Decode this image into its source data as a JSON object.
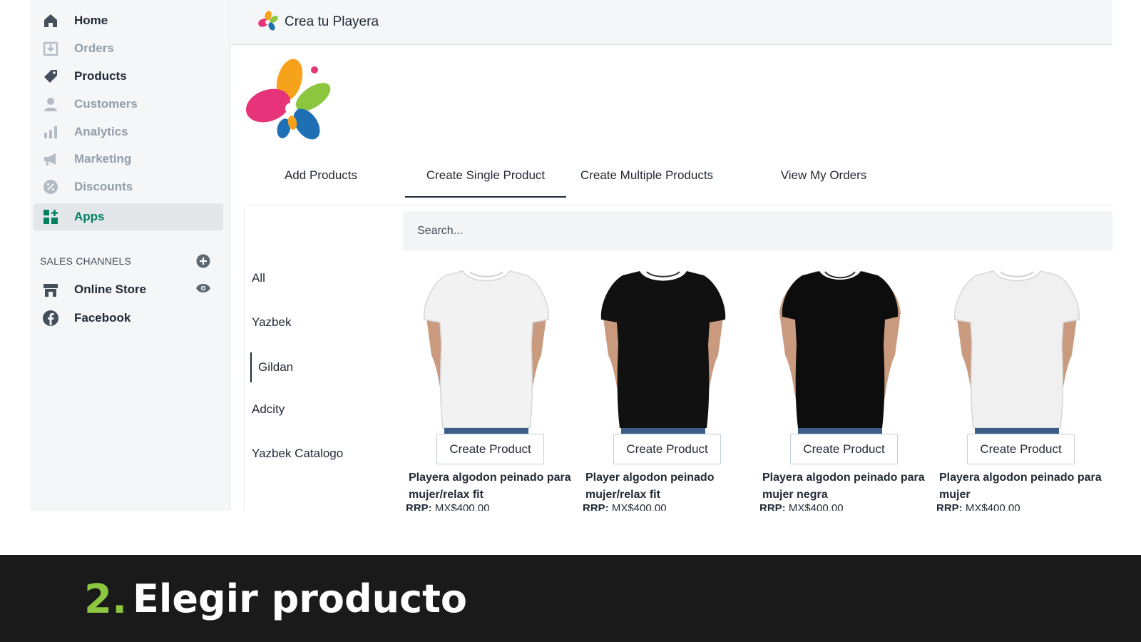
{
  "sidebar": {
    "items": [
      {
        "label": "Home",
        "icon": "home-icon"
      },
      {
        "label": "Orders",
        "icon": "orders-icon"
      },
      {
        "label": "Products",
        "icon": "tag-icon"
      },
      {
        "label": "Customers",
        "icon": "person-icon"
      },
      {
        "label": "Analytics",
        "icon": "bar-chart-icon"
      },
      {
        "label": "Marketing",
        "icon": "megaphone-icon"
      },
      {
        "label": "Discounts",
        "icon": "discount-icon"
      },
      {
        "label": "Apps",
        "icon": "apps-icon"
      }
    ],
    "channels_heading": "SALES CHANNELS",
    "channels": [
      {
        "label": "Online Store",
        "icon": "store-icon"
      },
      {
        "label": "Facebook",
        "icon": "facebook-icon"
      }
    ]
  },
  "header": {
    "title": "Crea tu Playera"
  },
  "tabs": [
    "Add Products",
    "Create Single Product",
    "Create Multiple Products",
    "View My Orders"
  ],
  "categories": [
    "All",
    "Yazbek",
    "Gildan",
    "Adcity",
    "Yazbek Catalogo"
  ],
  "search": {
    "placeholder": "Search..."
  },
  "products": [
    {
      "title": "Playera algodon peinado para mujer/relax fit",
      "price_label": "RRP:",
      "price": "MX$400.00",
      "button": "Create Product",
      "color": "#f2f2f2"
    },
    {
      "title": "Player algodon peinado mujer/relax fit",
      "price_label": "RRP:",
      "price": "MX$400.00",
      "button": "Create Product",
      "color": "#111111"
    },
    {
      "title": "Playera algodon peinado para mujer negra",
      "price_label": "RRP:",
      "price": "MX$400.00",
      "button": "Create Product",
      "color": "#0d0d0d"
    },
    {
      "title": "Playera algodon peinado para mujer",
      "price_label": "RRP:",
      "price": "MX$400.00",
      "button": "Create Product",
      "color": "#f0f0f0"
    }
  ],
  "banner": {
    "step": "2.",
    "text": "Elegir producto"
  },
  "colors": {
    "accent_green": "#008060",
    "banner_green": "#8dc63f",
    "banner_bg": "#1a1a1a"
  }
}
